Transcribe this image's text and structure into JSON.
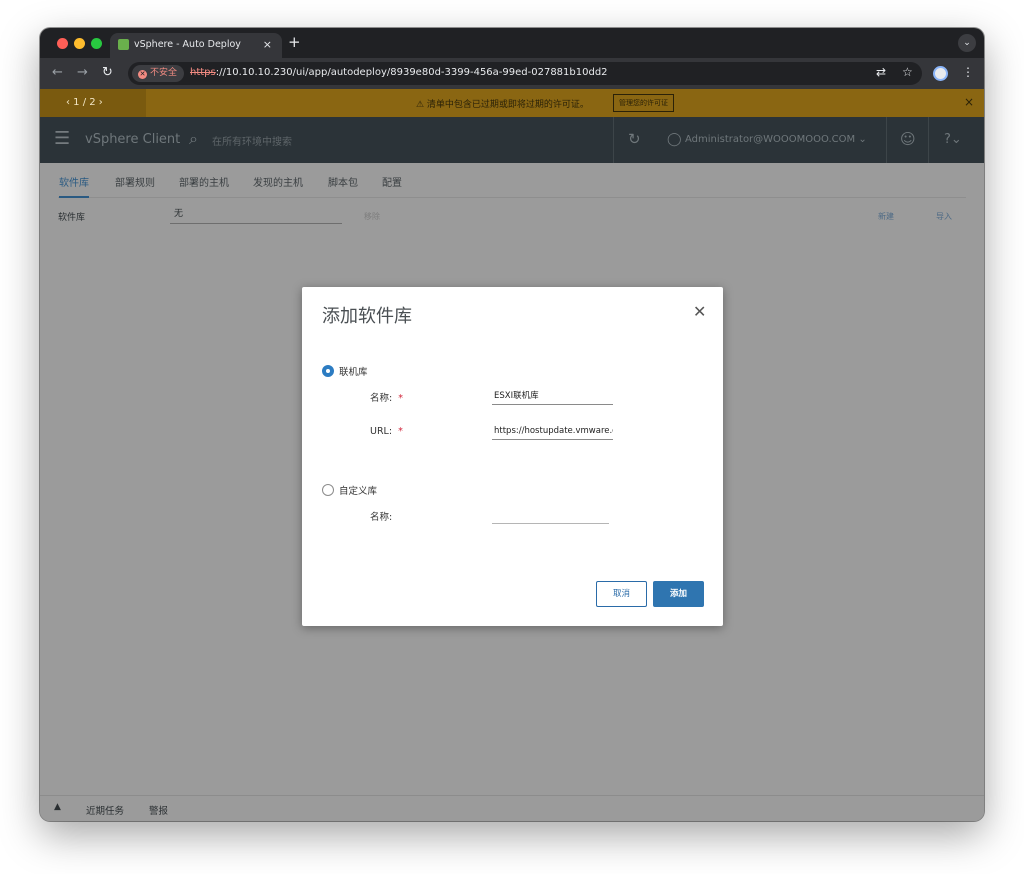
{
  "browser": {
    "tab_title": "vSphere - Auto Deploy",
    "tab_close": "×",
    "new_tab": "+",
    "tab_menu": "⌄",
    "security_label": "不安全",
    "url_scheme": "https",
    "url_rest": "://10.10.10.230/ui/app/autodeploy/8939e80d-3399-456a-99ed-027881b10dd2"
  },
  "license_bar": {
    "pager": "‹  1 / 2  ›",
    "message": "⚠  清单中包含已过期或即将过期的许可证。",
    "manage_button": "管理您的许可证",
    "close": "×"
  },
  "header": {
    "brand": "vSphere Client",
    "search_placeholder": "在所有环境中搜索",
    "user": "Administrator@WOOOMOOO.COM ⌄"
  },
  "subtabs": [
    "软件库",
    "部署规则",
    "部署的主机",
    "发现的主机",
    "脚本包",
    "配置"
  ],
  "toolbar": {
    "library_label": "软件库",
    "library_value": "无",
    "remove": "移除",
    "new": "新建",
    "import": "导入"
  },
  "bottom_bar": {
    "recent_tasks": "近期任务",
    "alarms": "警报"
  },
  "dialog": {
    "title": "添加软件库",
    "online": {
      "label": "联机库",
      "selected": true,
      "name_label": "名称:",
      "name_value": "ESXI联机库",
      "url_label": "URL:",
      "url_value": "https://hostupdate.vmware.com/software/VUM/PRODUCTION/main/vmw-depot-index.xml"
    },
    "custom": {
      "label": "自定义库",
      "selected": false,
      "name_label": "名称:",
      "name_value": ""
    },
    "required_mark": "*",
    "cancel": "取消",
    "add": "添加"
  }
}
